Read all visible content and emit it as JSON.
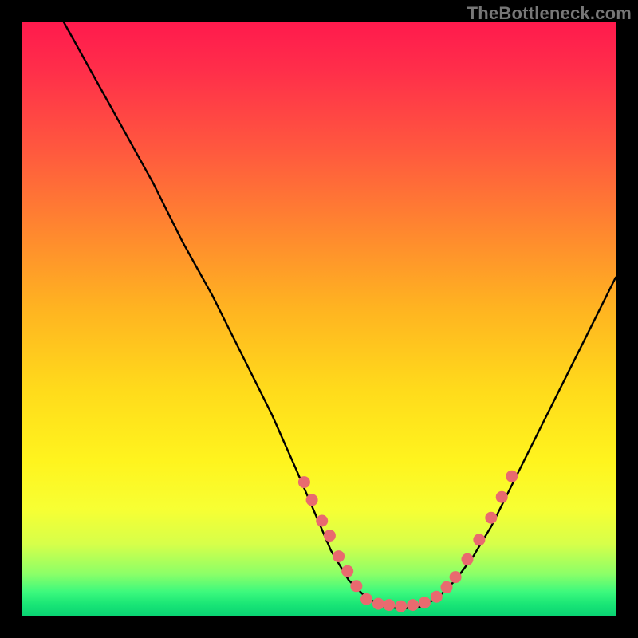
{
  "watermark": "TheBottleneck.com",
  "chart_data": {
    "type": "line",
    "title": "",
    "xlabel": "",
    "ylabel": "",
    "xlim": [
      0,
      100
    ],
    "ylim": [
      0,
      100
    ],
    "curve": {
      "name": "bottleneck-curve",
      "points_xy": [
        [
          7,
          100
        ],
        [
          12,
          91
        ],
        [
          17,
          82
        ],
        [
          22,
          73
        ],
        [
          27,
          63
        ],
        [
          32,
          54
        ],
        [
          37,
          44
        ],
        [
          42,
          34
        ],
        [
          46,
          25
        ],
        [
          49,
          18
        ],
        [
          52,
          11
        ],
        [
          55,
          6
        ],
        [
          58,
          3
        ],
        [
          61,
          1.5
        ],
        [
          64,
          1.2
        ],
        [
          67,
          1.5
        ],
        [
          70,
          3
        ],
        [
          73,
          6
        ],
        [
          76,
          10
        ],
        [
          79,
          15
        ],
        [
          83,
          23
        ],
        [
          88,
          33
        ],
        [
          94,
          45
        ],
        [
          100,
          57
        ]
      ]
    },
    "series": [
      {
        "name": "left-cluster",
        "color": "#e96a6f",
        "points_xy": [
          [
            47.5,
            22.5
          ],
          [
            48.8,
            19.5
          ],
          [
            50.5,
            16.0
          ],
          [
            51.8,
            13.5
          ],
          [
            53.3,
            10.0
          ],
          [
            54.8,
            7.5
          ],
          [
            56.3,
            5.0
          ]
        ]
      },
      {
        "name": "bottom-cluster",
        "color": "#e96a6f",
        "points_xy": [
          [
            58.0,
            2.8
          ],
          [
            60.0,
            2.0
          ],
          [
            61.8,
            1.8
          ],
          [
            63.8,
            1.6
          ],
          [
            65.8,
            1.8
          ],
          [
            67.8,
            2.2
          ],
          [
            69.8,
            3.2
          ],
          [
            71.5,
            4.8
          ],
          [
            73.0,
            6.5
          ]
        ]
      },
      {
        "name": "right-cluster",
        "color": "#e96a6f",
        "points_xy": [
          [
            75.0,
            9.5
          ],
          [
            77.0,
            12.8
          ],
          [
            79.0,
            16.5
          ],
          [
            80.8,
            20.0
          ],
          [
            82.5,
            23.5
          ]
        ]
      }
    ],
    "background_gradient": {
      "top": "#ff1a4d",
      "mid": "#ffe41e",
      "bottom": "#0ad473"
    }
  }
}
